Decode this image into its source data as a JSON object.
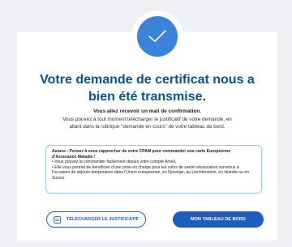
{
  "confirmation": {
    "title_line1": "Votre demande de certificat nous a",
    "title_line2": "bien été transmise.",
    "subtitle": "Vous allez recevoir un mail de confirmation.",
    "desc_line1": "Vous pouvez à tout moment télécharger le justificatif de votre demande, en",
    "desc_line2": "allant dans la rubrique \"demande en cours\"  de votre tableau de bord."
  },
  "tip": {
    "title": "Astuce : Pensez à vous rapprocher de votre CPAM pour commander une carte Européenne d'Assurance Maladie !",
    "bullet1": "• Vous pouvez la commander facilement depuis votre compte Ameli,",
    "bullet2": "• Elle vous permet de bénéficier d'une prise en charge pour les soins de santé nécessaires survenus à l'occasion de séjours temporaires dans l'Union européenne, en Norvège, au Liechtenstein, en Islande ou en Suisse."
  },
  "buttons": {
    "download_label": "TELECHARGER LE JUSTIFICATIF",
    "dashboard_label": "MON TABLEAU DE BORD"
  },
  "icons": {
    "status": "check-icon",
    "download": "document-icon"
  },
  "colors": {
    "accent": "#3b82d9",
    "title": "#0b4f8e",
    "primary_button": "#1f5dbd",
    "tip_border": "#9cc7f0"
  }
}
